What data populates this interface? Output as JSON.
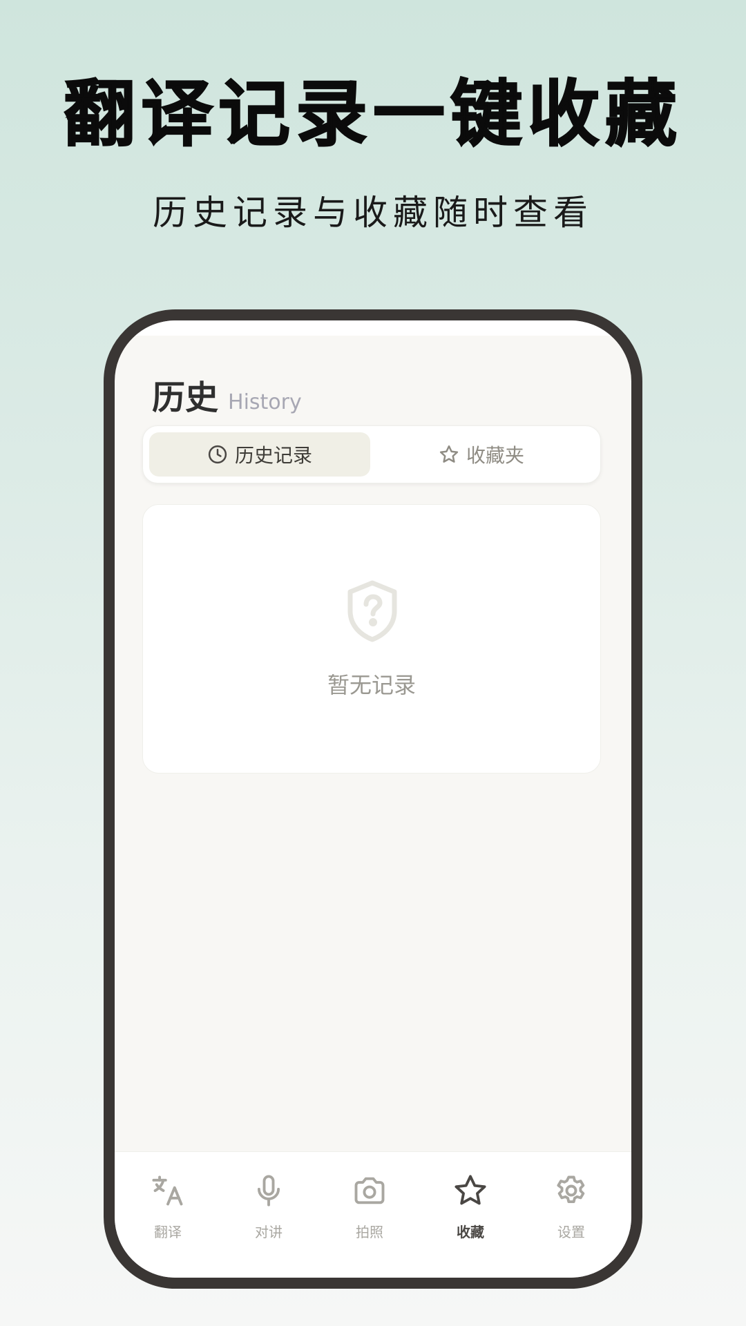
{
  "promo": {
    "title": "翻译记录一键收藏",
    "subtitle": "历史记录与收藏随时查看"
  },
  "page": {
    "title": "历史",
    "subtitle": "History"
  },
  "tabs": [
    {
      "label": "历史记录",
      "icon": "clock-icon",
      "active": true
    },
    {
      "label": "收藏夹",
      "icon": "star-icon",
      "active": false
    }
  ],
  "empty_state": {
    "icon": "shield-question-icon",
    "text": "暂无记录"
  },
  "bottom_nav": [
    {
      "label": "翻译",
      "icon": "translate-icon",
      "active": false
    },
    {
      "label": "对讲",
      "icon": "microphone-icon",
      "active": false
    },
    {
      "label": "拍照",
      "icon": "camera-icon",
      "active": false
    },
    {
      "label": "收藏",
      "icon": "star-icon",
      "active": true
    },
    {
      "label": "设置",
      "icon": "gear-icon",
      "active": false
    }
  ],
  "colors": {
    "accent_active_tab_bg": "#f0efe6",
    "active_icon": "#4a4744",
    "inactive_icon": "#a9a7a1",
    "frame": "#3a3634"
  }
}
